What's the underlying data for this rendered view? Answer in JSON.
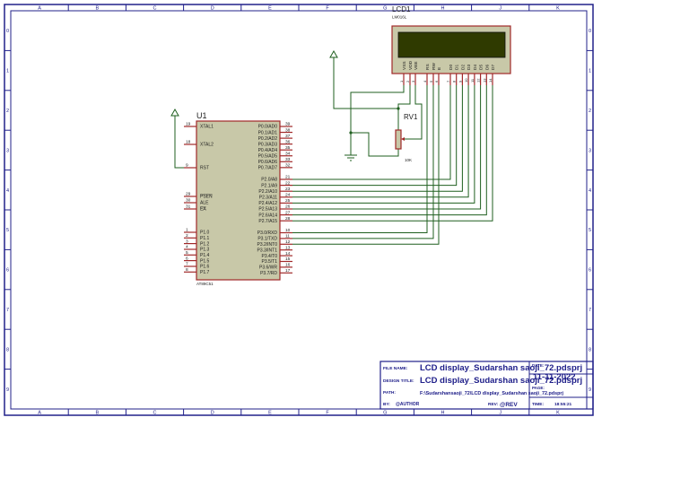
{
  "sheet": {
    "columns": [
      "A",
      "B",
      "C",
      "D",
      "E",
      "F",
      "G",
      "H",
      "J",
      "K"
    ],
    "rows": [
      "0",
      "1",
      "2",
      "3",
      "4",
      "5",
      "6",
      "7",
      "8",
      "9"
    ]
  },
  "mcu": {
    "ref": "U1",
    "part": "AT89C51",
    "left_pins": [
      {
        "num": "19",
        "label": "XTAL1"
      },
      {
        "num": "18",
        "label": "XTAL2"
      },
      {
        "num": "9",
        "label": "RST"
      },
      {
        "num": "29",
        "label": "PSEN",
        "overbar": true
      },
      {
        "num": "30",
        "label": "ALE"
      },
      {
        "num": "31",
        "label": "EA",
        "overbar": true
      },
      {
        "num": "1",
        "label": "P1.0"
      },
      {
        "num": "2",
        "label": "P1.1"
      },
      {
        "num": "3",
        "label": "P1.2"
      },
      {
        "num": "4",
        "label": "P1.3"
      },
      {
        "num": "5",
        "label": "P1.4"
      },
      {
        "num": "6",
        "label": "P1.5"
      },
      {
        "num": "7",
        "label": "P1.6"
      },
      {
        "num": "8",
        "label": "P1.7"
      }
    ],
    "right_pins": [
      {
        "num": "39",
        "label": "P0.0/AD0"
      },
      {
        "num": "38",
        "label": "P0.1/AD1"
      },
      {
        "num": "37",
        "label": "P0.2/AD2"
      },
      {
        "num": "36",
        "label": "P0.3/AD3"
      },
      {
        "num": "35",
        "label": "P0.4/AD4"
      },
      {
        "num": "34",
        "label": "P0.5/AD5"
      },
      {
        "num": "33",
        "label": "P0.6/AD6"
      },
      {
        "num": "32",
        "label": "P0.7/AD7"
      },
      {
        "num": "21",
        "label": "P2.0/A8"
      },
      {
        "num": "22",
        "label": "P2.1/A9"
      },
      {
        "num": "23",
        "label": "P2.2/A10"
      },
      {
        "num": "24",
        "label": "P2.3/A11"
      },
      {
        "num": "25",
        "label": "P2.4/A12"
      },
      {
        "num": "26",
        "label": "P2.5/A13"
      },
      {
        "num": "27",
        "label": "P2.6/A14"
      },
      {
        "num": "28",
        "label": "P2.7/A15"
      },
      {
        "num": "10",
        "label": "P3.0/RXD"
      },
      {
        "num": "11",
        "label": "P3.1/TXD"
      },
      {
        "num": "12",
        "label": "P3.2/INT0"
      },
      {
        "num": "13",
        "label": "P3.3/INT1"
      },
      {
        "num": "14",
        "label": "P3.4/T0"
      },
      {
        "num": "15",
        "label": "P3.5/T1"
      },
      {
        "num": "16",
        "label": "P3.6/WR"
      },
      {
        "num": "17",
        "label": "P3.7/RD"
      }
    ]
  },
  "lcd": {
    "ref": "LCD1",
    "part": "LM016L",
    "pins": [
      {
        "num": "1",
        "label": "VSS"
      },
      {
        "num": "2",
        "label": "VDD"
      },
      {
        "num": "3",
        "label": "VEE"
      },
      {
        "num": "4",
        "label": "RS"
      },
      {
        "num": "5",
        "label": "RW"
      },
      {
        "num": "6",
        "label": "E"
      },
      {
        "num": "7",
        "label": "D0"
      },
      {
        "num": "8",
        "label": "D1"
      },
      {
        "num": "9",
        "label": "D2"
      },
      {
        "num": "10",
        "label": "D3"
      },
      {
        "num": "11",
        "label": "D4"
      },
      {
        "num": "12",
        "label": "D5"
      },
      {
        "num": "13",
        "label": "D6"
      },
      {
        "num": "14",
        "label": "D7"
      }
    ],
    "screen_color": "#2f3a00"
  },
  "pot": {
    "ref": "RV1",
    "value": "10K"
  },
  "title_block": {
    "file_name_label": "FILE NAME:",
    "file_name": "LCD display_Sudarshan saoji_72.pdsprj",
    "design_title_label": "DESIGN TITLE:",
    "design_title": "LCD display_Sudarshan saoji_72.pdsprj",
    "path_label": "PATH:",
    "path": "F:\\Sudarshansaoji_72\\LCD display_Sudarshan saoji_72.pdsprj",
    "by_label": "BY:",
    "author": "@AUTHOR",
    "rev_label": "REV:",
    "rev": "@REV",
    "date_label": "DATE:",
    "date": "11-11-2022",
    "page_label": "PAGE:",
    "time_label": "TIME:",
    "time": "18:55:21"
  },
  "colors": {
    "frame": "#20208a",
    "wire": "#1f5f1f",
    "pin": "#a02828",
    "body_fill": "#c8c8a8",
    "body_stroke": "#a02828",
    "text": "#202020"
  }
}
